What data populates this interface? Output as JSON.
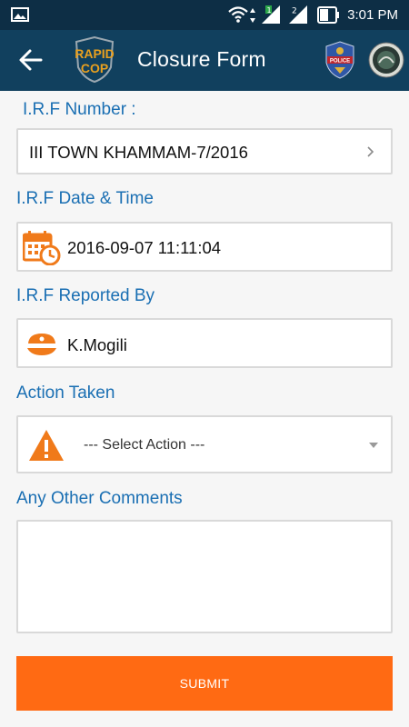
{
  "status_bar": {
    "time": "3:01 PM",
    "icons": [
      "image-icon",
      "wifi-icon",
      "data-arrows-icon",
      "signal-sim1-icon",
      "signal-sim2-icon",
      "battery-icon"
    ]
  },
  "app_bar": {
    "title": "Closure Form",
    "logo_line1": "RAPID",
    "logo_line2": "COP",
    "badge1_text": "POLICE"
  },
  "form": {
    "irf_number": {
      "label": "I.R.F Number :",
      "value": "III TOWN KHAMMAM-7/2016"
    },
    "irf_datetime": {
      "label": "I.R.F Date & Time",
      "value": "2016-09-07 11:11:04"
    },
    "irf_reported_by": {
      "label": "I.R.F Reported By",
      "value": "K.Mogili"
    },
    "action_taken": {
      "label": "Action Taken",
      "selected": "--- Select Action ---"
    },
    "comments": {
      "label": "Any Other Comments",
      "value": ""
    },
    "submit_label": "SUBMIT"
  },
  "colors": {
    "status_bar": "#0d2e45",
    "app_bar": "#11405e",
    "label_blue": "#1a6fb3",
    "accent_orange": "#ff6a13"
  }
}
